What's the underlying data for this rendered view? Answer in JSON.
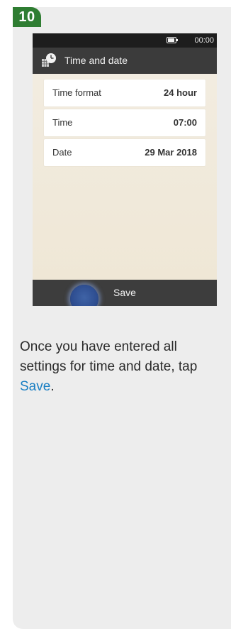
{
  "step": {
    "number": "10"
  },
  "status_bar": {
    "time": "00:00",
    "battery_icon": "battery-icon"
  },
  "screen": {
    "title": "Time and date",
    "title_icon": "clock-calendar-icon",
    "rows": [
      {
        "label": "Time format",
        "value": "24 hour"
      },
      {
        "label": "Time",
        "value": "07:00"
      },
      {
        "label": "Date",
        "value": "29 Mar 2018"
      }
    ],
    "save_label": "Save"
  },
  "instruction": {
    "text_before": "Once you have entered all settings for time and date, tap ",
    "link_text": "Save",
    "text_after": "."
  },
  "colors": {
    "step_badge": "#2f7d32",
    "link": "#1a7fc3",
    "header_dark": "#3b3b3b"
  }
}
